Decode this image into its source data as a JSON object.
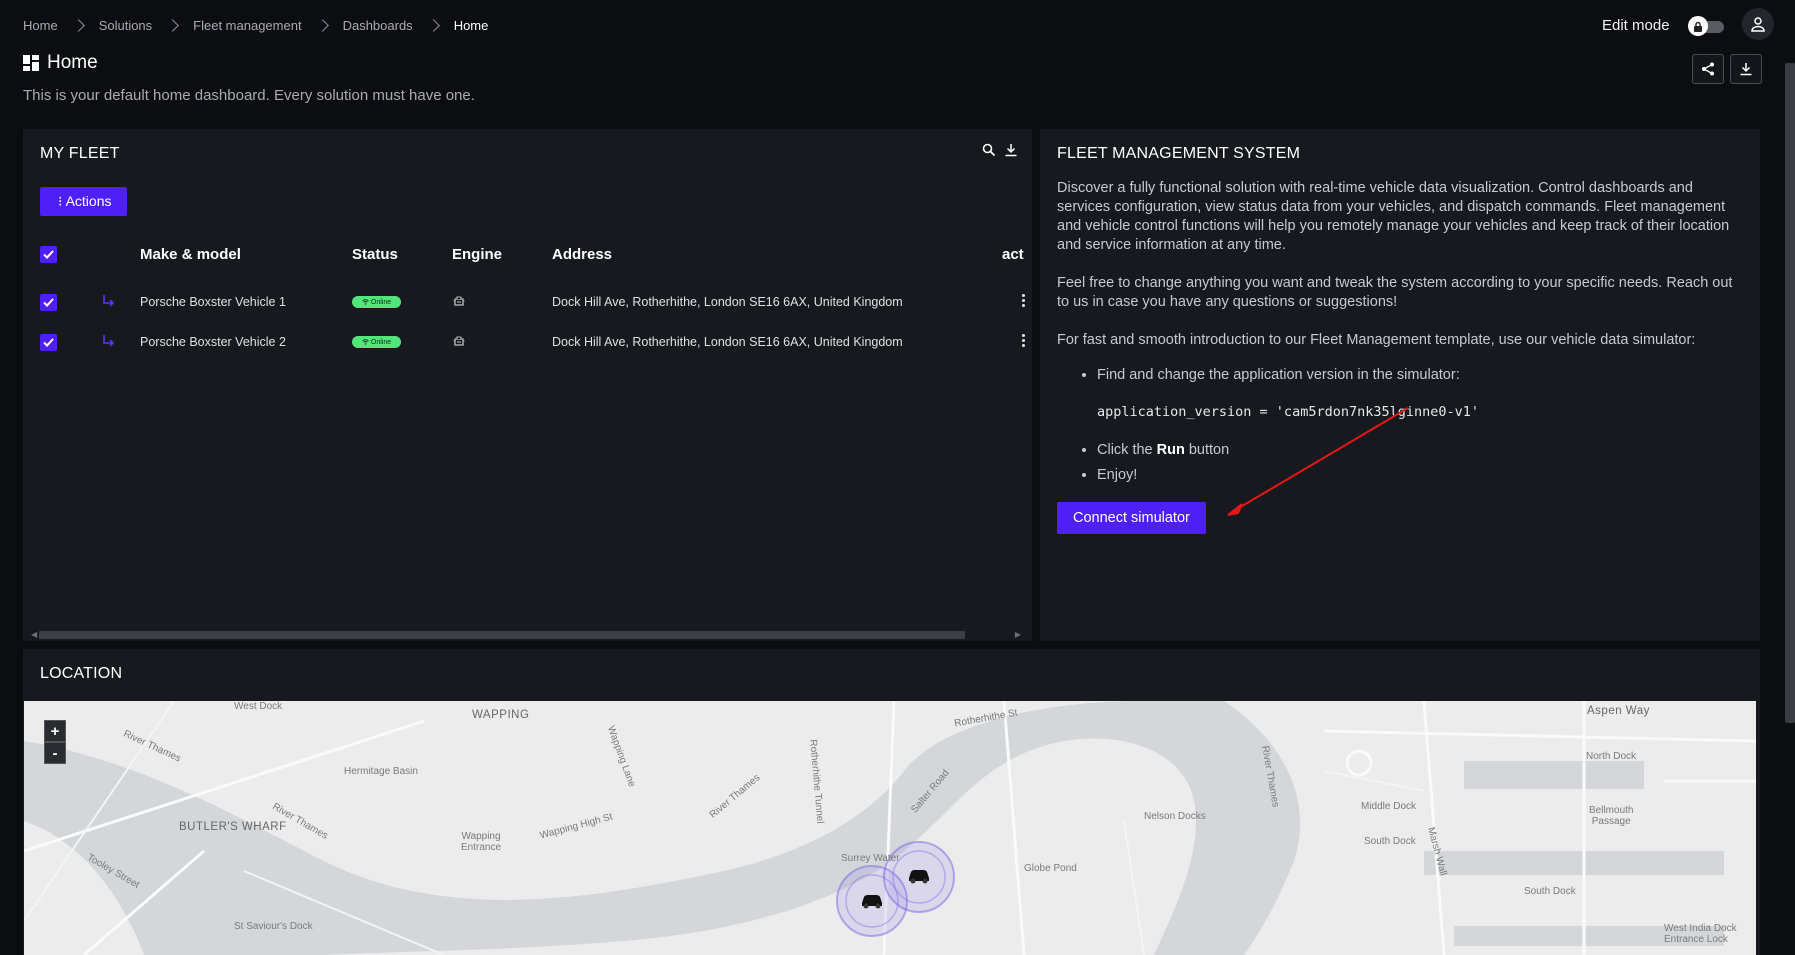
{
  "breadcrumb": [
    "Home",
    "Solutions",
    "Fleet management",
    "Dashboards",
    "Home"
  ],
  "topbar": {
    "edit_mode_label": "Edit mode"
  },
  "page": {
    "title": "Home",
    "description": "This is your default home dashboard. Every solution must have one."
  },
  "fleet": {
    "title": "MY FLEET",
    "actions_label": "⁝ Actions",
    "columns": [
      "Make & model",
      "Status",
      "Engine",
      "Address",
      "act"
    ],
    "rows": [
      {
        "name": "Porsche Boxster Vehicle 1",
        "status": "Online",
        "address": "Dock Hill Ave, Rotherhithe, London SE16 6AX, United Kingdom"
      },
      {
        "name": "Porsche Boxster Vehicle 2",
        "status": "Online",
        "address": "Dock Hill Ave, Rotherhithe, London SE16 6AX, United Kingdom"
      }
    ]
  },
  "fms": {
    "title": "FLEET MANAGEMENT SYSTEM",
    "paragraphs": [
      "Discover a fully functional solution with real-time vehicle data visualization. Control dashboards and services configuration, view status data from your vehicles, and dispatch commands. Fleet management and vehicle control functions will help you remotely manage your vehicles and keep track of their location and service information at any time.",
      "Feel free to change anything you want and tweak the system according to your specific needs. Reach out to us in case you have any questions or suggestions!",
      "For fast and smooth introduction to our Fleet Management template, use our vehicle data simulator:"
    ],
    "step1": "Find and change the application version in the simulator:",
    "code": "application_version = 'cam5rdon7nk35lginne0-v1'",
    "step2_prefix": "Click the ",
    "step2_bold": "Run",
    "step2_suffix": " button",
    "step3": "Enjoy!",
    "connect_label": "Connect simulator"
  },
  "location": {
    "title": "LOCATION",
    "zoom_in": "+",
    "zoom_out": "-",
    "labels": {
      "wapping": "WAPPING",
      "butlers_wharf": "BUTLER'S WHARF",
      "hermitage_basin": "Hermitage Basin",
      "river_thames_1": "River Thames",
      "river_thames_2": "River Thames",
      "river_thames_3": "River Thames",
      "river_thames_4": "River Thames",
      "wapping_entrance": "Wapping\nEntrance",
      "wapping_high_st": "Wapping High St",
      "wapping_lane": "Wapping Lane",
      "rotherhithe_st": "Rotherhithe St",
      "rotherhithe_tunnel": "Rotherhithe Tunnel",
      "salter_road": "Salter Road",
      "surrey_water": "Surrey Water",
      "globe_pond": "Globe Pond",
      "nelson_docks": "Nelson Docks",
      "aspen_way": "Aspen Way",
      "north_dock": "North Dock",
      "middle_dock": "Middle Dock",
      "south_dock": "South Dock",
      "south_dock_2": "South Dock",
      "bellmouth_passage": "Bellmouth\nPassage",
      "west_india_dock": "West India Dock\nEntrance Lock",
      "tooley_street": "Tooley Street",
      "st_saviours_dock": "St Saviour's Dock",
      "west_dock": "West Dock",
      "marsh_wall": "Marsh Wall"
    }
  },
  "colors": {
    "accent": "#4f20f5",
    "online": "#52e67a",
    "panel": "#18191e",
    "background": "#0c0d10"
  }
}
